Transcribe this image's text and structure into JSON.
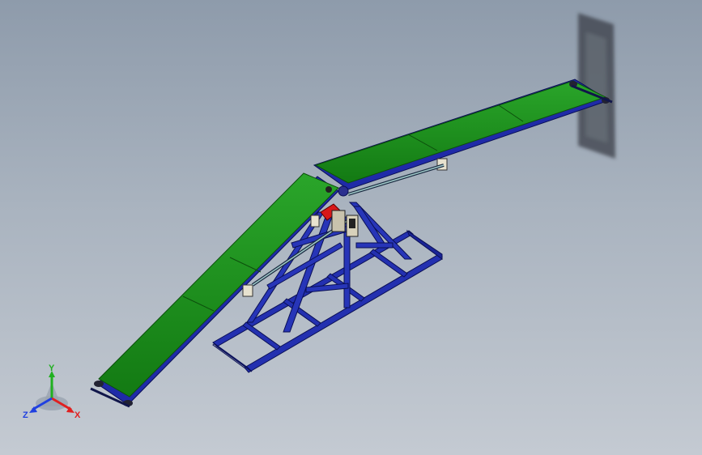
{
  "triad": {
    "x_label": "X",
    "y_label": "Y",
    "z_label": "Z",
    "colors": {
      "x": "#e02020",
      "y": "#20b020",
      "z": "#2040e0"
    }
  },
  "model": {
    "belt_color": "#1f9b1f",
    "frame_color": "#1f2aa8",
    "motor_color": "#d81818"
  }
}
